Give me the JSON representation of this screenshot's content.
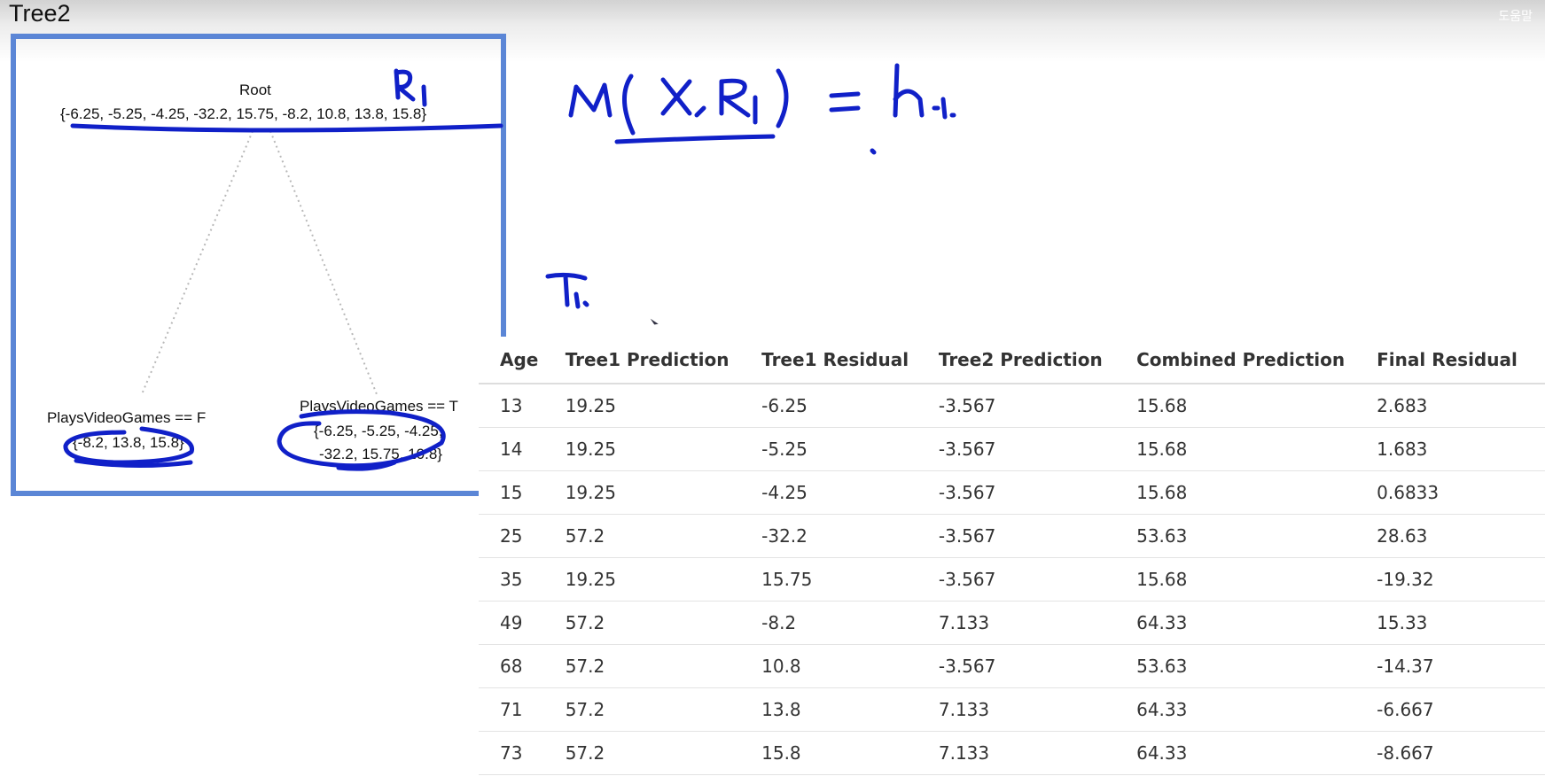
{
  "window": {
    "title": "Tree2",
    "help_label": "도움말"
  },
  "tree": {
    "root": {
      "label": "Root",
      "values": "{-6.25, -5.25, -4.25, -32.2, 15.75, -8.2, 10.8, 13.8, 15.8}"
    },
    "left": {
      "label": "PlaysVideoGames == F",
      "values": "{-8.2, 13.8, 15.8}"
    },
    "right": {
      "label": "PlaysVideoGames == T",
      "values_line1": "{-6.25, -5.25, -4.25,",
      "values_line2": "-32.2, 15.75, 10.8}"
    }
  },
  "annotations": {
    "r1_label": "R1",
    "formula": "M(X, R1) = h.1.",
    "t1_label": "T1."
  },
  "table": {
    "headers": [
      "Age",
      "Tree1 Prediction",
      "Tree1 Residual",
      "Tree2 Prediction",
      "Combined Prediction",
      "Final Residual"
    ],
    "rows": [
      [
        "13",
        "19.25",
        "-6.25",
        "-3.567",
        "15.68",
        "2.683"
      ],
      [
        "14",
        "19.25",
        "-5.25",
        "-3.567",
        "15.68",
        "1.683"
      ],
      [
        "15",
        "19.25",
        "-4.25",
        "-3.567",
        "15.68",
        "0.6833"
      ],
      [
        "25",
        "57.2",
        "-32.2",
        "-3.567",
        "53.63",
        "28.63"
      ],
      [
        "35",
        "19.25",
        "15.75",
        "-3.567",
        "15.68",
        "-19.32"
      ],
      [
        "49",
        "57.2",
        "-8.2",
        "7.133",
        "64.33",
        "15.33"
      ],
      [
        "68",
        "57.2",
        "10.8",
        "-3.567",
        "53.63",
        "-14.37"
      ],
      [
        "71",
        "57.2",
        "13.8",
        "7.133",
        "64.33",
        "-6.667"
      ],
      [
        "73",
        "57.2",
        "15.8",
        "7.133",
        "64.33",
        "-8.667"
      ]
    ]
  },
  "colors": {
    "frame": "#5b86d6",
    "ink": "#1020c8"
  }
}
